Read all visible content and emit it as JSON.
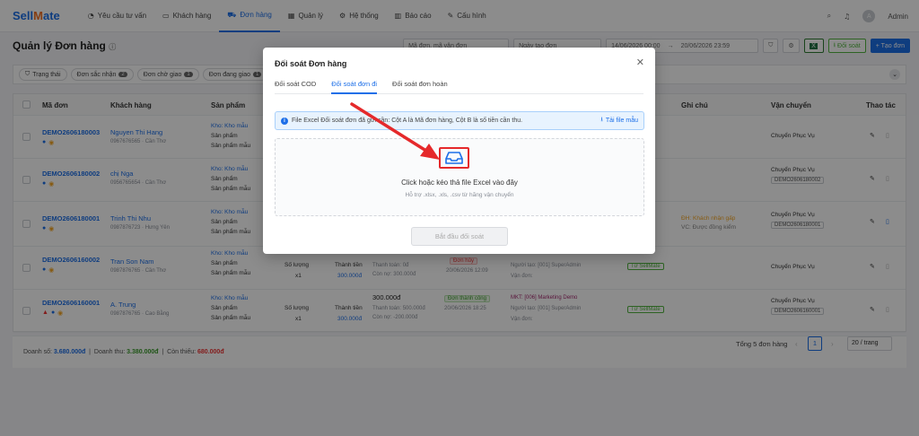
{
  "brand": {
    "part1": "Sell",
    "part2": "ate",
    "logo_mark": "M"
  },
  "nav": [
    {
      "label": "Yêu cầu tư vấn",
      "icon": "chat-icon"
    },
    {
      "label": "Khách hàng",
      "icon": "contact-icon"
    },
    {
      "label": "Đơn hàng",
      "icon": "cart-icon",
      "active": true
    },
    {
      "label": "Quản lý",
      "icon": "grid-icon"
    },
    {
      "label": "Hệ thống",
      "icon": "gear-icon"
    },
    {
      "label": "Báo cáo",
      "icon": "chart-icon"
    },
    {
      "label": "Cấu hình",
      "icon": "tools-icon"
    }
  ],
  "user": {
    "name": "Admin",
    "initial": "A"
  },
  "page": {
    "title": "Quản lý Đơn hàng"
  },
  "toolbar": {
    "search_placeholder": "Mã đơn, mã vận đơn",
    "date_type": "Ngày tạo đơn",
    "date_from": "14/06/2026 00:00",
    "date_to": "20/06/2026 23:59",
    "doi_soat": "Đối soát",
    "excel": "X",
    "create": "+ Tạo đơn"
  },
  "filters": [
    {
      "label": "Trạng thái",
      "count": ""
    },
    {
      "label": "Đơn sắc nhận",
      "count": "2"
    },
    {
      "label": "Đơn chờ giao",
      "count": "1"
    },
    {
      "label": "Đơn đang giao",
      "count": "1"
    }
  ],
  "table": {
    "headers": [
      "Mã đơn",
      "Khách hàng",
      "Sản phẩm",
      "Ghi chú",
      "Vận chuyển",
      "Thao tác"
    ],
    "rows": [
      {
        "code": "DEMO2606180003",
        "customer": "Nguyen Thi Hang",
        "phone": "0967676565 · Cần Thơ",
        "kho": "Kho: Kho mẫu",
        "p1": "Sản phẩm",
        "p2": "Sản phẩm mẫu",
        "note": "",
        "note2": "",
        "ship": "Chuyển Phục Vụ",
        "ship_code": ""
      },
      {
        "code": "DEMO2606180002",
        "customer": "chị Nga",
        "phone": "0956765654 · Cần Thơ",
        "kho": "Kho: Kho mẫu",
        "p1": "Sản phẩm",
        "p2": "Sản phẩm mẫu",
        "note": "",
        "note2": "",
        "ship": "Chuyển Phục Vụ",
        "ship_code": "DEMO2606180002"
      },
      {
        "code": "DEMO2606180001",
        "customer": "Trinh Thi Nhu",
        "phone": "0987876723 · Hưng Yên",
        "kho": "Kho: Kho mẫu",
        "p1": "Sản phẩm",
        "p2": "Sản phẩm mẫu",
        "note": "ĐH: Khách nhận gấp",
        "note2": "VC: Được đồng kiểm",
        "ship": "Chuyển Phục Vụ",
        "ship_code": "DEMO2606180001"
      },
      {
        "code": "DEMO2606160002",
        "customer": "Tran Son Nam",
        "phone": "0987876765 · Cần Thơ",
        "kho": "Kho: Kho mẫu",
        "p1": "Sản phẩm",
        "p2": "Sản phẩm mẫu",
        "qty_label": "Số lượng",
        "qty": "x1",
        "total_label": "Thành tiền",
        "total": "300.000đ",
        "paid_label": "Thanh toán: 0đ",
        "remain": "Còn nợ: 300.000đ",
        "status": "Đơn hủy",
        "date": "20/06/2026 12:09",
        "creator": "Người tạo: [001] SuperAdmin",
        "vandon": "Vận đơn:",
        "source": "Từ SellMate",
        "note": "",
        "note2": "",
        "ship": "Chuyển Phục Vụ",
        "ship_code": "DEMO2606160002"
      },
      {
        "code": "DEMO2606160001",
        "customer": "A. Trung",
        "phone": "0987876765 · Cao Bằng",
        "kho": "Kho: Kho mẫu",
        "p1": "Sản phẩm",
        "p2": "Sản phẩm mẫu",
        "qty_label": "Số lượng",
        "qty": "x1",
        "total_label": "Thành tiền",
        "total": "300.000đ",
        "big_total": "300.000đ",
        "paid_label": "Thanh toán: 500.000đ",
        "remain": "Còn nợ: -200.000đ",
        "status": "Đơn thành công",
        "date": "20/06/2026 18:25",
        "mkt": "MKT: [006] Marketing Demo",
        "creator": "Người tạo: [001] SuperAdmin",
        "vandon": "Vận đơn:",
        "source": "Từ SellMate",
        "note": "",
        "note2": "",
        "ship": "Chuyển Phục Vụ",
        "ship_code": "DEMO2606160001"
      }
    ]
  },
  "summary": {
    "doanh_so_label": "Doanh số:",
    "doanh_so": "3.680.000đ",
    "doanh_thu_label": "Doanh thu:",
    "doanh_thu": "3.380.000đ",
    "con_thieu_label": "Còn thiếu:",
    "con_thieu": "680.000đ"
  },
  "pagination": {
    "total": "Tổng 5 đơn hàng",
    "page": "1",
    "per_page": "20 / trang"
  },
  "modal": {
    "title": "Đối soát Đơn hàng",
    "tabs": [
      "Đối soát COD",
      "Đối soát đơn đi",
      "Đối soát đơn hoàn"
    ],
    "active_tab": 1,
    "info": "File Excel Đối soát đơn đã gửi cần: Cột A là Mã đơn hàng, Cột B là số tiền cần thu.",
    "download": "Tải file mẫu",
    "drop_title": "Click hoặc kéo thả file Excel vào đây",
    "drop_sub": "Hỗ trợ .xlsx, .xls, .csv từ hãng vận chuyển",
    "start": "Bắt đầu đối soát"
  },
  "colors": {
    "primary": "#1d6fe8",
    "brand_orange": "#f36f21",
    "annotation_red": "#e5292b"
  }
}
